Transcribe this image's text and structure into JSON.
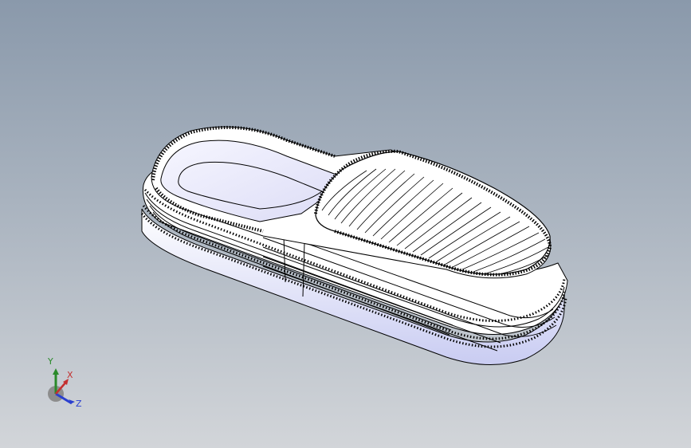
{
  "viewport": {
    "background_top": "#8a99ab",
    "background_bottom": "#d2d5d9",
    "model_name": "slipper",
    "line_color": "#000000",
    "face_color": "#ffffff"
  },
  "triad": {
    "x_label": "X",
    "y_label": "Y",
    "z_label": "Z",
    "x_color": "#c43030",
    "y_color": "#2a8a2a",
    "z_color": "#2a3fcf",
    "icon": "axis-triad-icon"
  }
}
